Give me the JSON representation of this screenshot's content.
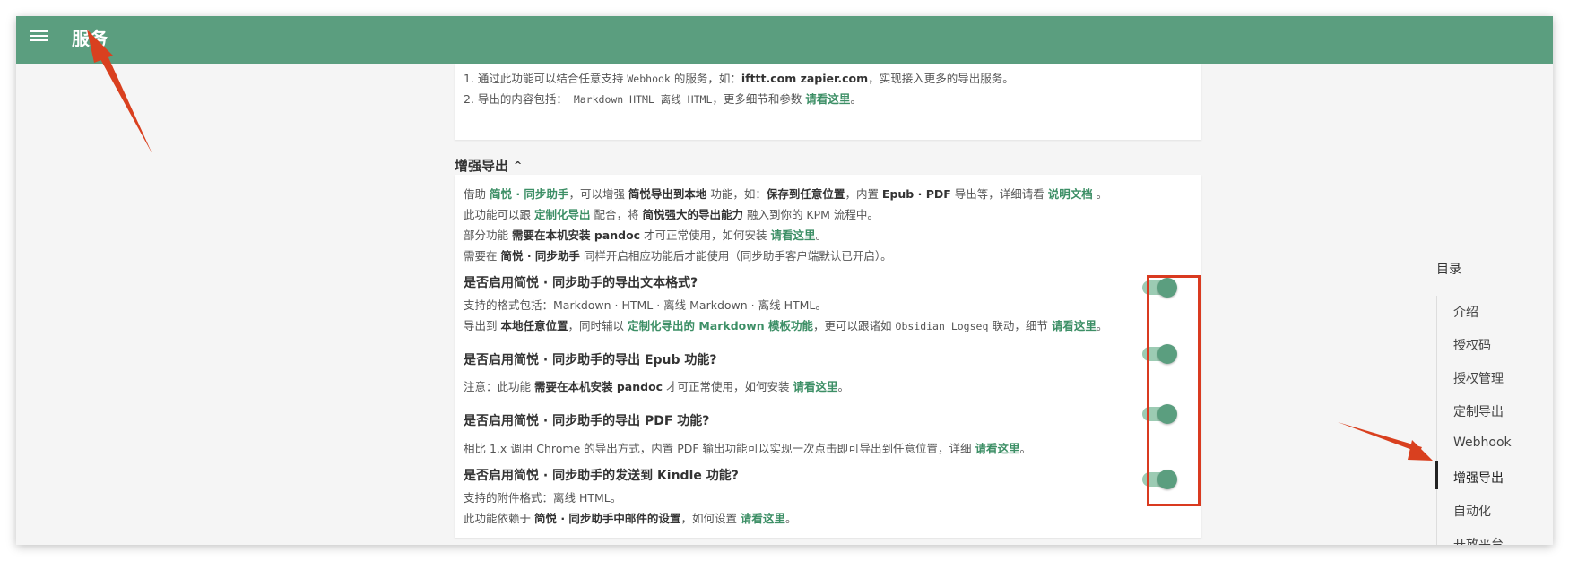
{
  "appbar": {
    "title": "服务"
  },
  "intro_notes": {
    "line1": {
      "p1": "1. 通过此功能可以结合任意支持 ",
      "mono": "Webhook",
      "p2": " 的服务，如：",
      "b": "ifttt.com zapier.com",
      "p3": "，实现接入更多的导出服务。"
    },
    "line2": {
      "p1": "2. 导出的内容包括：",
      "mono": " Markdown HTML 离线 HTML",
      "p2": "，更多细节和参数 ",
      "link": "请看这里",
      "p3": "。"
    }
  },
  "section": {
    "title": "增强导出",
    "chevron": "^"
  },
  "desc": {
    "l1": {
      "p1": "借助 ",
      "link1": "简悦 · 同步助手",
      "p2": "，可以增强 ",
      "b1": "简悦导出到本地",
      "p3": " 功能，如：",
      "b2": "保存到任意位置",
      "p4": "，内置 ",
      "b3": "Epub · PDF",
      "p5": " 导出等，详细请看 ",
      "link2": "说明文档",
      "p6": " 。"
    },
    "l2": {
      "p1": "此功能可以跟 ",
      "link1": "定制化导出",
      "p2": " 配合，将 ",
      "b1": "简悦强大的导出能力",
      "p3": " 融入到你的 KPM 流程中。"
    },
    "l3": {
      "p1": "部分功能 ",
      "b1": "需要在本机安装 pandoc",
      "p2": " 才可正常使用，如何安装 ",
      "link1": "请看这里",
      "p3": "。"
    },
    "l4": {
      "p1": "需要在 ",
      "b1": "简悦 · 同步助手",
      "p2": " 同样开启相应功能后才能使用（同步助手客户端默认已开启）。"
    }
  },
  "options": [
    {
      "question": "是否启用简悦 · 同步助手的导出文本格式?",
      "d1": {
        "p1": "支持的格式包括：Markdown · HTML · 离线 Markdown · 离线 HTML。"
      },
      "d2": {
        "p1": "导出到 ",
        "b1": "本地任意位置",
        "p2": "，同时辅以 ",
        "link1": "定制化导出的 Markdown 模板功能",
        "p3": "，更可以跟诸如 ",
        "mono": "Obsidian Logseq",
        "p4": " 联动，细节 ",
        "link2": "请看这里",
        "p5": "。"
      },
      "enabled": true
    },
    {
      "question": "是否启用简悦 · 同步助手的导出 Epub 功能?",
      "d1": {
        "p1": "注意：此功能 ",
        "b1": "需要在本机安装 pandoc",
        "p2": " 才可正常使用，如何安装 ",
        "link1": "请看这里",
        "p3": "。"
      },
      "enabled": true
    },
    {
      "question": "是否启用简悦 · 同步助手的导出 PDF 功能?",
      "d1": {
        "p1": "相比 1.x 调用 Chrome 的导出方式，内置 PDF 输出功能可以实现一次点击即可导出到任意位置，详细 ",
        "link1": "请看这里",
        "p2": "。"
      },
      "enabled": true
    },
    {
      "question": "是否启用简悦 · 同步助手的发送到 Kindle 功能?",
      "d1": {
        "p1": "支持的附件格式：离线 HTML。"
      },
      "d2": {
        "p1": "此功能依赖于 ",
        "b1": "简悦 · 同步助手中邮件的设置",
        "p2": "，如何设置 ",
        "link1": "请看这里",
        "p3": "。"
      },
      "enabled": true
    }
  ],
  "toc": {
    "title": "目录",
    "items": [
      "介绍",
      "授权码",
      "授权管理",
      "定制导出",
      "Webhook",
      "增强导出",
      "自动化",
      "开放平台"
    ],
    "active_index": 5
  },
  "colors": {
    "appbar": "#5b9e7f",
    "link": "#3d8f66",
    "highlight": "#d93a20"
  }
}
